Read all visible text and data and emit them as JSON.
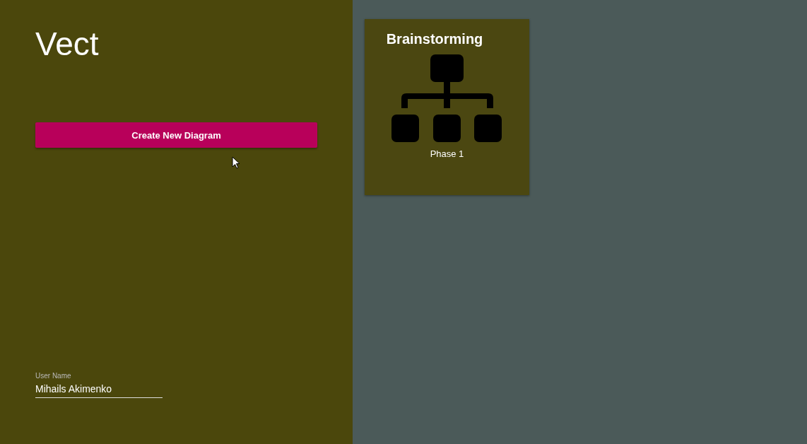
{
  "app_title": "Vect",
  "create_button": {
    "label": "Create New Diagram"
  },
  "user_field": {
    "label": "User Name",
    "value": "Mihails Akimenko"
  },
  "diagrams": [
    {
      "title": "Brainstorming",
      "subtitle": "Phase 1"
    }
  ]
}
